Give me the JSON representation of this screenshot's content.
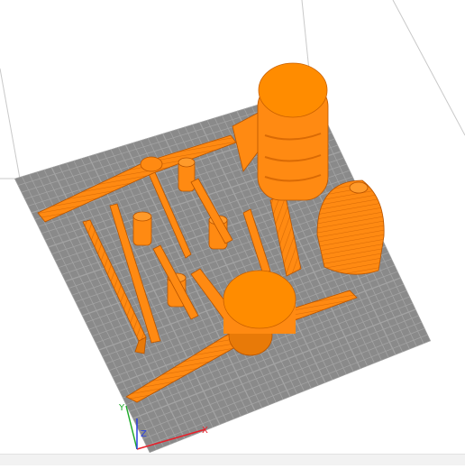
{
  "viewport": {
    "background_color": "#ffffff",
    "bed_color": "#8a8a8a",
    "grid_color": "#a3a3a3",
    "model_color": "#ff8a12",
    "model_shade_color": "#d96a05",
    "model_top_color": "#ff8c00"
  },
  "axes": {
    "x": {
      "label": "X",
      "color": "#e8202a"
    },
    "y": {
      "label": "Y",
      "color": "#1faa2a"
    },
    "z": {
      "label": "Z",
      "color": "#2a40e0"
    }
  }
}
